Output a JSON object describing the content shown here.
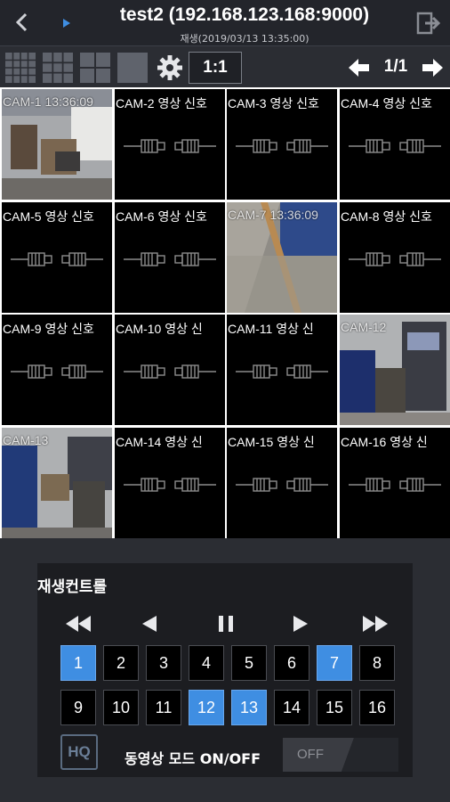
{
  "header": {
    "title": "test2 (192.168.123.168:9000)",
    "subtitle": "재생(2019/03/13  13:35:00)"
  },
  "toolbar": {
    "ratio_label": "1:1",
    "page_indicator": "1/1",
    "layout_options": [
      "4x4",
      "3x3",
      "2x2",
      "1x1"
    ]
  },
  "cameras": [
    {
      "label": "CAM-1  13:36:09",
      "has_video": true
    },
    {
      "label": "CAM-2 영상 신호",
      "has_video": false
    },
    {
      "label": "CAM-3 영상 신호",
      "has_video": false
    },
    {
      "label": "CAM-4 영상 신호",
      "has_video": false
    },
    {
      "label": "CAM-5 영상 신호",
      "has_video": false
    },
    {
      "label": "CAM-6 영상 신호",
      "has_video": false
    },
    {
      "label": "CAM-7  13:36:09",
      "has_video": true
    },
    {
      "label": "CAM-8 영상 신호",
      "has_video": false
    },
    {
      "label": "CAM-9 영상 신호",
      "has_video": false
    },
    {
      "label": "CAM-10 영상 신",
      "has_video": false
    },
    {
      "label": "CAM-11 영상 신",
      "has_video": false
    },
    {
      "label": "CAM-12",
      "has_video": true
    },
    {
      "label": "CAM-13",
      "has_video": true
    },
    {
      "label": "CAM-14 영상 신",
      "has_video": false
    },
    {
      "label": "CAM-15 영상 신",
      "has_video": false
    },
    {
      "label": "CAM-16 영상 신",
      "has_video": false
    }
  ],
  "playback": {
    "title": "재생컨트롤",
    "channels": [
      {
        "label": "1",
        "selected": true
      },
      {
        "label": "2",
        "selected": false
      },
      {
        "label": "3",
        "selected": false
      },
      {
        "label": "4",
        "selected": false
      },
      {
        "label": "5",
        "selected": false
      },
      {
        "label": "6",
        "selected": false
      },
      {
        "label": "7",
        "selected": true
      },
      {
        "label": "8",
        "selected": false
      },
      {
        "label": "9",
        "selected": false
      },
      {
        "label": "10",
        "selected": false
      },
      {
        "label": "11",
        "selected": false
      },
      {
        "label": "12",
        "selected": true
      },
      {
        "label": "13",
        "selected": true
      },
      {
        "label": "14",
        "selected": false
      },
      {
        "label": "15",
        "selected": false
      },
      {
        "label": "16",
        "selected": false
      }
    ],
    "hq_label": "HQ",
    "mode_label": "동영상 모드 ON/OFF",
    "toggle_state": "OFF"
  },
  "colors": {
    "accent_blue": "#3f8ee2",
    "header_bg": "#23252b",
    "panel_bg": "#1c1d21"
  }
}
